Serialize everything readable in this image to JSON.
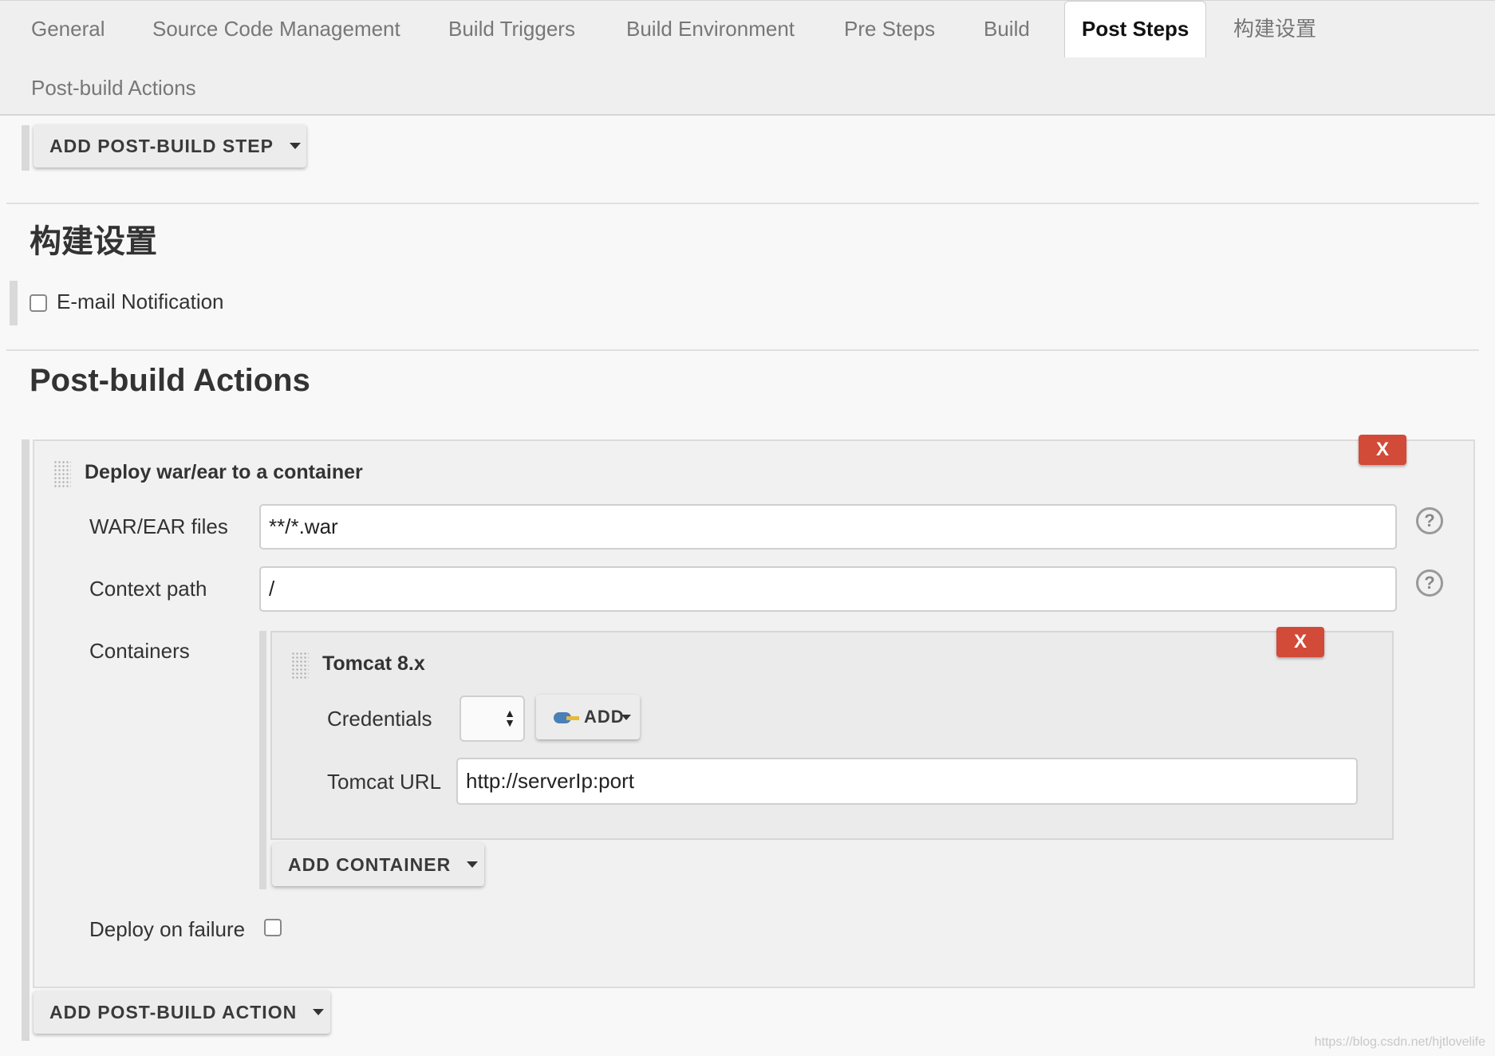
{
  "tabs": [
    {
      "label": "General",
      "active": false
    },
    {
      "label": "Source Code Management",
      "active": false
    },
    {
      "label": "Build Triggers",
      "active": false
    },
    {
      "label": "Build Environment",
      "active": false
    },
    {
      "label": "Pre Steps",
      "active": false
    },
    {
      "label": "Build",
      "active": false
    },
    {
      "label": "Post Steps",
      "active": true
    },
    {
      "label": "构建设置",
      "active": false
    },
    {
      "label": "Post-build Actions",
      "active": false
    }
  ],
  "post_steps": {
    "add_button": "ADD POST-BUILD STEP"
  },
  "build_settings": {
    "title": "构建设置",
    "email_notification": {
      "label": "E-mail Notification",
      "checked": false
    }
  },
  "post_build": {
    "title": "Post-build Actions",
    "deploy": {
      "title": "Deploy war/ear to a container",
      "remove_label": "X",
      "war_label": "WAR/EAR files",
      "war_value": "**/*.war",
      "context_label": "Context path",
      "context_value": "/",
      "help_glyph": "?",
      "containers_label": "Containers",
      "tomcat": {
        "title": "Tomcat 8.x",
        "remove_label": "X",
        "credentials_label": "Credentials",
        "credentials_value": "",
        "add_label": "ADD",
        "url_label": "Tomcat URL",
        "url_value": "http://serverIp:port"
      },
      "add_container": "ADD CONTAINER",
      "deploy_on_failure_label": "Deploy on failure",
      "deploy_on_failure_checked": false
    },
    "add_button": "ADD POST-BUILD ACTION"
  },
  "watermark": "https://blog.csdn.net/hjtlovelife",
  "colors": {
    "accent_remove": "#d24a38",
    "tab_bar": "#efefef",
    "page_bg": "#f8f8f8"
  }
}
